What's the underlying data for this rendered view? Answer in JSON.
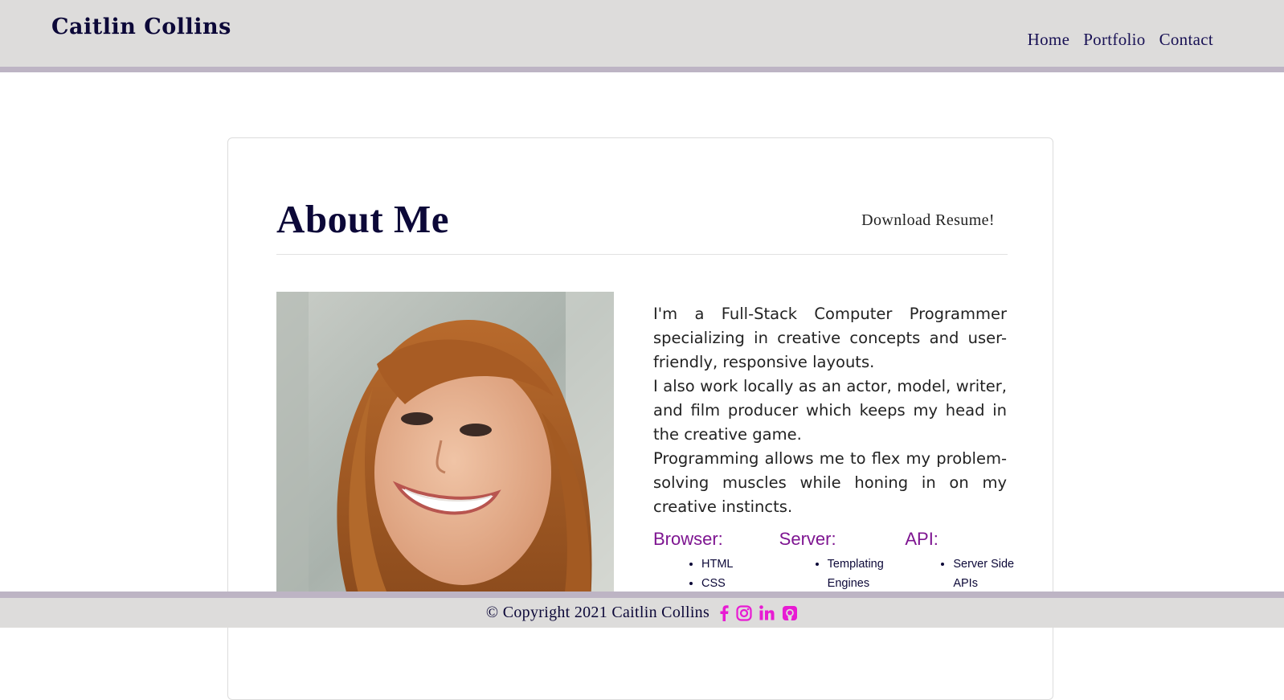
{
  "header": {
    "brand": "Caitlin Collins",
    "nav": [
      "Home",
      "Portfolio",
      "Contact"
    ]
  },
  "about": {
    "title": "About Me",
    "resume_label": "Download Resume!",
    "bio": [
      "I'm a Full-Stack Computer Programmer specializing in creative concepts and user-friendly, responsive layouts.",
      "I also work locally as an actor, model, writer, and film producer which keeps my head in the creative game.",
      "Programming allows me to flex my problem-solving muscles while honing in on my creative instincts."
    ],
    "skills": [
      {
        "title": "Browser:",
        "items": [
          "HTML",
          "CSS"
        ]
      },
      {
        "title": "Server:",
        "items": [
          "Templating Engines"
        ]
      },
      {
        "title": "API:",
        "items": [
          "Server Side APIs"
        ]
      }
    ]
  },
  "footer": {
    "copyright": "© Copyright 2021 Caitlin Collins",
    "social_icons": [
      "facebook-icon",
      "instagram-icon",
      "linkedin-icon",
      "github-icon"
    ]
  },
  "colors": {
    "header_bg": "#dddcdb",
    "header_border": "#bdb4c4",
    "navy": "#0c0838",
    "skill_heading": "#7e1591",
    "social_icon": "#e81bd3"
  }
}
